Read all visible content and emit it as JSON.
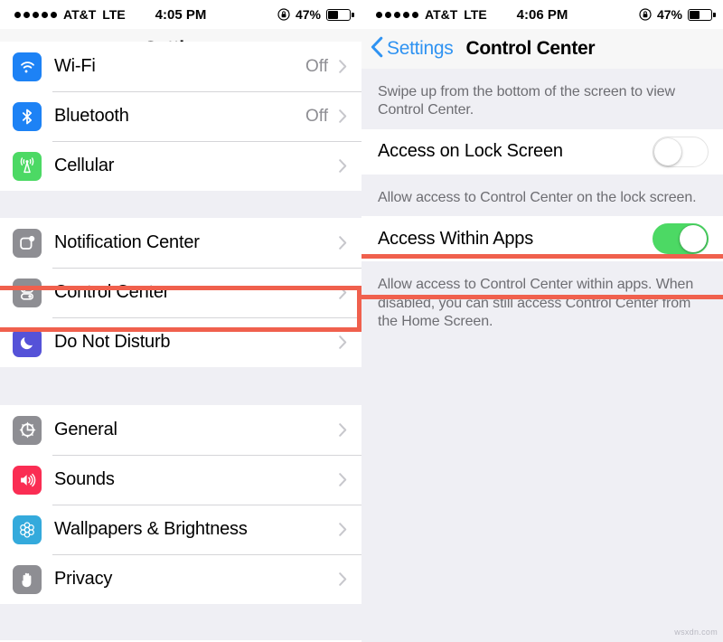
{
  "left": {
    "statusbar": {
      "signal_dots": 5,
      "carrier": "AT&T",
      "network": "LTE",
      "time": "4:05 PM",
      "battery_percent": "47%",
      "battery_level": 47,
      "lock_icon": "rotation-lock-icon"
    },
    "navbar": {
      "title": "Settings"
    },
    "groups": [
      {
        "rows": [
          {
            "icon": "wifi-icon",
            "icon_color": "#1d82f5",
            "label": "Wi-Fi",
            "value": "Off",
            "chevron": true,
            "clipped": true
          },
          {
            "icon": "bluetooth-icon",
            "icon_color": "#1d82f5",
            "label": "Bluetooth",
            "value": "Off",
            "chevron": true
          },
          {
            "icon": "cellular-icon",
            "icon_color": "#4cd964",
            "label": "Cellular",
            "value": "",
            "chevron": true
          }
        ]
      },
      {
        "rows": [
          {
            "icon": "notification-center-icon",
            "icon_color": "#8e8e93",
            "label": "Notification Center",
            "value": "",
            "chevron": true
          },
          {
            "icon": "control-center-icon",
            "icon_color": "#8e8e93",
            "label": "Control Center",
            "value": "",
            "chevron": true,
            "highlighted": true
          },
          {
            "icon": "do-not-disturb-icon",
            "icon_color": "#5552d8",
            "label": "Do Not Disturb",
            "value": "",
            "chevron": true
          }
        ]
      },
      {
        "rows": [
          {
            "icon": "gear-icon",
            "icon_color": "#8e8e93",
            "label": "General",
            "value": "",
            "chevron": true
          },
          {
            "icon": "sounds-icon",
            "icon_color": "#fa2d53",
            "label": "Sounds",
            "value": "",
            "chevron": true
          },
          {
            "icon": "wallpaper-icon",
            "icon_color": "#34aadc",
            "label": "Wallpapers & Brightness",
            "value": "",
            "chevron": true
          },
          {
            "icon": "privacy-icon",
            "icon_color": "#8e8e93",
            "label": "Privacy",
            "value": "",
            "chevron": true
          }
        ]
      }
    ]
  },
  "right": {
    "statusbar": {
      "signal_dots": 5,
      "carrier": "AT&T",
      "network": "LTE",
      "time": "4:06 PM",
      "battery_percent": "47%",
      "battery_level": 47,
      "lock_icon": "rotation-lock-icon"
    },
    "navbar": {
      "back_label": "Settings",
      "back_icon": "chevron-left-icon",
      "title": "Control Center"
    },
    "intro_footnote": "Swipe up from the bottom of the screen to view Control Center.",
    "settings": [
      {
        "label": "Access on Lock Screen",
        "toggle_state": "off",
        "toggle_color": "#ffffff",
        "highlighted": true,
        "footnote": "Allow access to Control Center on the lock screen."
      },
      {
        "label": "Access Within Apps",
        "toggle_state": "on",
        "toggle_color": "#4cd964",
        "highlighted": false,
        "footnote": "Allow access to Control Center within apps. When disabled, you can still access Control Center from the Home Screen."
      }
    ]
  },
  "annotation": {
    "highlight_color": "#f0604d"
  },
  "watermark": "wsxdn.com"
}
